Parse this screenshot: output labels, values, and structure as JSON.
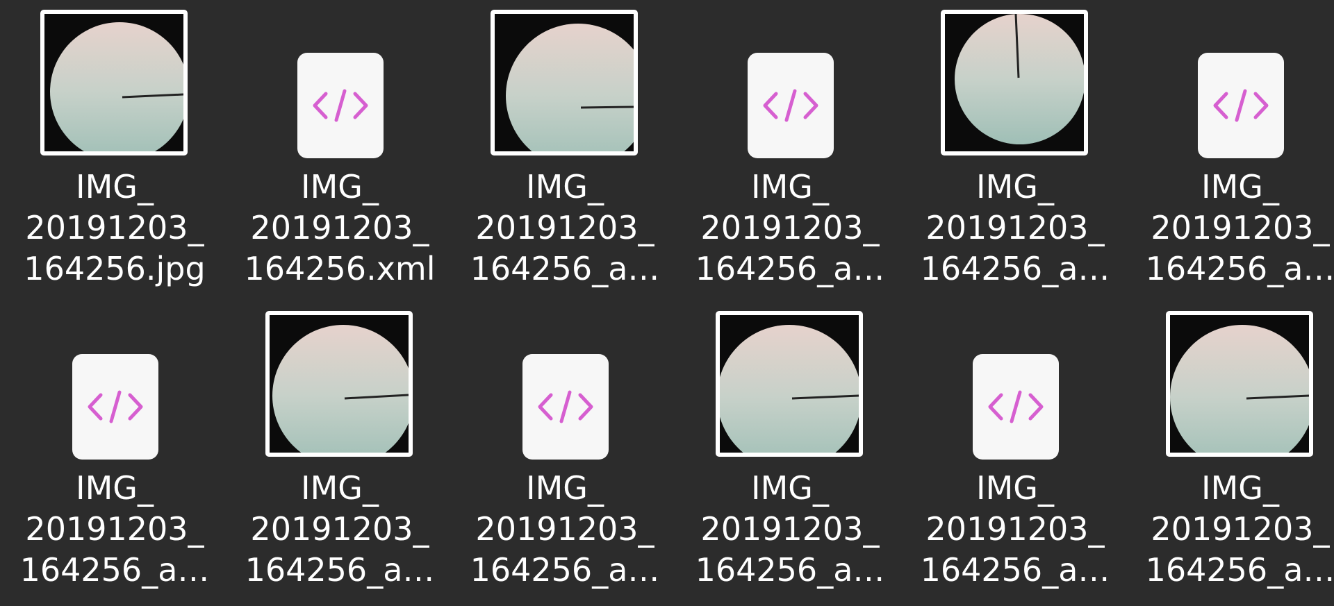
{
  "files": [
    {
      "type": "image",
      "line1": "IMG_",
      "line2": "20191203_",
      "line3": "164256.jpg",
      "pointer": "right-mid"
    },
    {
      "type": "xml",
      "line1": "IMG_",
      "line2": "20191203_",
      "line3": "164256.xml"
    },
    {
      "type": "image",
      "line1": "IMG_",
      "line2": "20191203_",
      "line3": "164256_a…",
      "pointer": "right-mid"
    },
    {
      "type": "xml",
      "line1": "IMG_",
      "line2": "20191203_",
      "line3": "164256_a…"
    },
    {
      "type": "image",
      "line1": "IMG_",
      "line2": "20191203_",
      "line3": "164256_a…",
      "pointer": "top"
    },
    {
      "type": "xml",
      "line1": "IMG_",
      "line2": "20191203_",
      "line3": "164256_a…"
    },
    {
      "type": "xml",
      "line1": "IMG_",
      "line2": "20191203_",
      "line3": "164256_a…"
    },
    {
      "type": "image",
      "line1": "IMG_",
      "line2": "20191203_",
      "line3": "164256_a…",
      "pointer": "right-mid"
    },
    {
      "type": "xml",
      "line1": "IMG_",
      "line2": "20191203_",
      "line3": "164256_a…"
    },
    {
      "type": "image",
      "line1": "IMG_",
      "line2": "20191203_",
      "line3": "164256_a…",
      "pointer": "right-mid"
    },
    {
      "type": "xml",
      "line1": "IMG_",
      "line2": "20191203_",
      "line3": "164256_a…"
    },
    {
      "type": "image",
      "line1": "IMG_",
      "line2": "20191203_",
      "line3": "164256_a…",
      "pointer": "right-mid"
    }
  ],
  "colors": {
    "background": "#2c2c2c",
    "xml_glyph": "#d65fd0",
    "xml_icon_bg": "#f7f7f7",
    "dish_top": "#e6d2cc",
    "dish_bottom": "#9fbfb6",
    "label": "#ffffff"
  },
  "icons": {
    "xml": "xml-code-icon",
    "image": "image-thumbnail"
  }
}
